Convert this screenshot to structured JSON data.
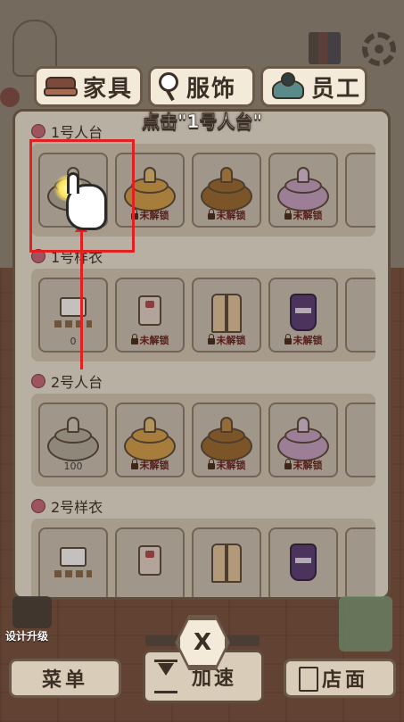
{
  "tabs": [
    {
      "label": "家具",
      "icon": "sofa-icon"
    },
    {
      "label": "服饰",
      "icon": "mirror-icon"
    },
    {
      "label": "员工",
      "icon": "staff-icon"
    }
  ],
  "hint": "点击\"1号人台\"",
  "sections": [
    {
      "title": "1号人台",
      "kind": "stand",
      "cards": [
        {
          "variant": "gray",
          "caption": ""
        },
        {
          "variant": "gold",
          "caption": "未解锁",
          "locked": true
        },
        {
          "variant": "brown",
          "caption": "未解锁",
          "locked": true
        },
        {
          "variant": "pink",
          "caption": "未解锁",
          "locked": true
        }
      ]
    },
    {
      "title": "1号样衣",
      "kind": "cloth",
      "cards": [
        {
          "variant": "tee",
          "caption": "0"
        },
        {
          "variant": "blouse",
          "caption": "未解锁",
          "locked": true
        },
        {
          "variant": "coat",
          "caption": "未解锁",
          "locked": true
        },
        {
          "variant": "dress",
          "caption": "未解锁",
          "locked": true
        }
      ]
    },
    {
      "title": "2号人台",
      "kind": "stand",
      "cards": [
        {
          "variant": "gray",
          "caption": "100"
        },
        {
          "variant": "gold",
          "caption": "未解锁",
          "locked": true
        },
        {
          "variant": "brown",
          "caption": "未解锁",
          "locked": true
        },
        {
          "variant": "pink",
          "caption": "未解锁",
          "locked": true
        }
      ]
    },
    {
      "title": "2号样衣",
      "kind": "cloth",
      "cards": [
        {
          "variant": "tee",
          "caption": ""
        },
        {
          "variant": "blouse",
          "caption": ""
        },
        {
          "variant": "coat",
          "caption": ""
        },
        {
          "variant": "dress",
          "caption": ""
        }
      ]
    }
  ],
  "bottom": {
    "design_upgrade": "设计升级",
    "menu": "菜单",
    "speed": "加速",
    "shop": "店面",
    "close": "X"
  },
  "colors": {
    "highlight": "#e32020",
    "panel": "#f1e9db",
    "border": "#5e4c3d",
    "locked_text": "#6a1e1e"
  }
}
